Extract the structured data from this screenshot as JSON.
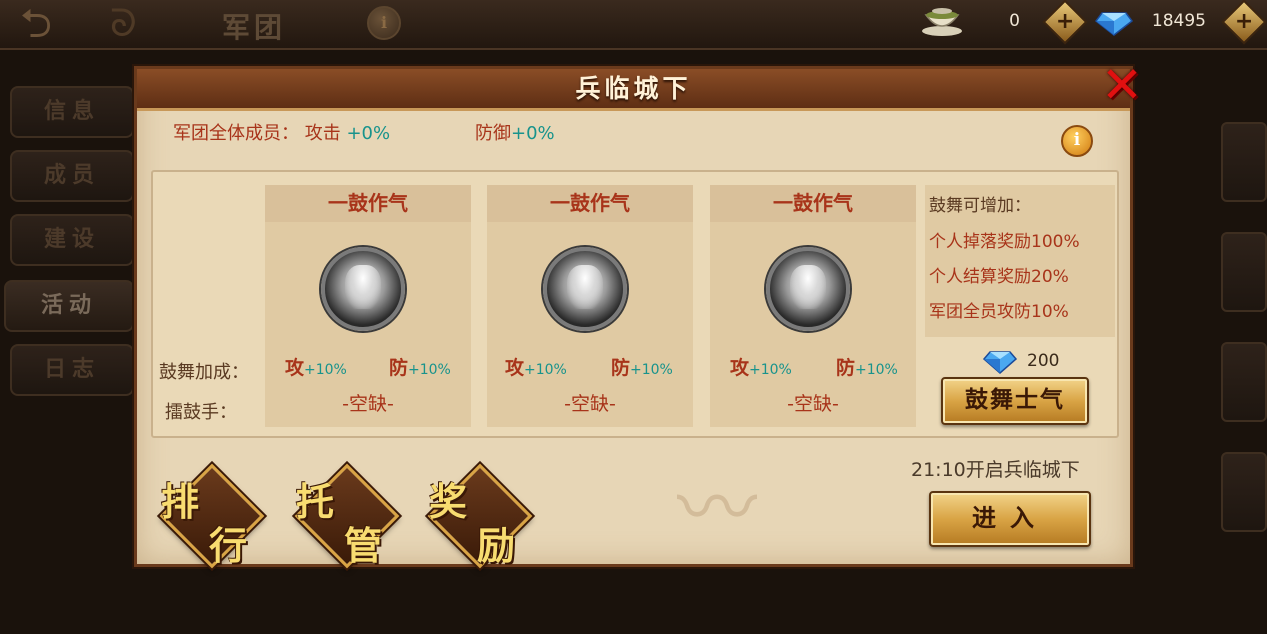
{
  "topbar": {
    "title": "军团",
    "info_icon": "i",
    "tea": {
      "icon": "tea-cup-icon",
      "value": "0"
    },
    "gems": {
      "icon": "diamond-icon",
      "value": "18495"
    },
    "plus": "+"
  },
  "nav": {
    "items": [
      "信息",
      "成员",
      "建设",
      "活动",
      "日志"
    ],
    "active": "活动"
  },
  "dialog": {
    "title": "兵临城下",
    "close": "✕",
    "bonus": {
      "label": "军团全体成员：",
      "atk_label": "攻击",
      "atk_value": "+0%",
      "def_label": "防御",
      "def_value": "+0%"
    },
    "info_icon": "i",
    "row_labels": {
      "cheer_bonus": "鼓舞加成：",
      "drummer": "擂鼓手："
    },
    "drums": [
      {
        "title": "一鼓作气",
        "atk": "攻",
        "atk_pct": "+10%",
        "def": "防",
        "def_pct": "+10%",
        "drummer": "-空缺-"
      },
      {
        "title": "一鼓作气",
        "atk": "攻",
        "atk_pct": "+10%",
        "def": "防",
        "def_pct": "+10%",
        "drummer": "-空缺-"
      },
      {
        "title": "一鼓作气",
        "atk": "攻",
        "atk_pct": "+10%",
        "def": "防",
        "def_pct": "+10%",
        "drummer": "-空缺-"
      }
    ],
    "cheer": {
      "title": "鼓舞可增加：",
      "lines": [
        "个人掉落奖励100%",
        "个人结算奖励20%",
        "军团全员攻防10%"
      ],
      "cost": "200",
      "button": "鼓舞士气"
    },
    "open_time": "21:10开启兵临城下",
    "enter_button": "进入",
    "actions": [
      {
        "c1": "排",
        "c2": "行"
      },
      {
        "c1": "托",
        "c2": "管"
      },
      {
        "c1": "奖",
        "c2": "励"
      }
    ]
  },
  "colors": {
    "accent_red": "#a8341a",
    "accent_teal": "#18938c",
    "gold": "#d9a445"
  }
}
